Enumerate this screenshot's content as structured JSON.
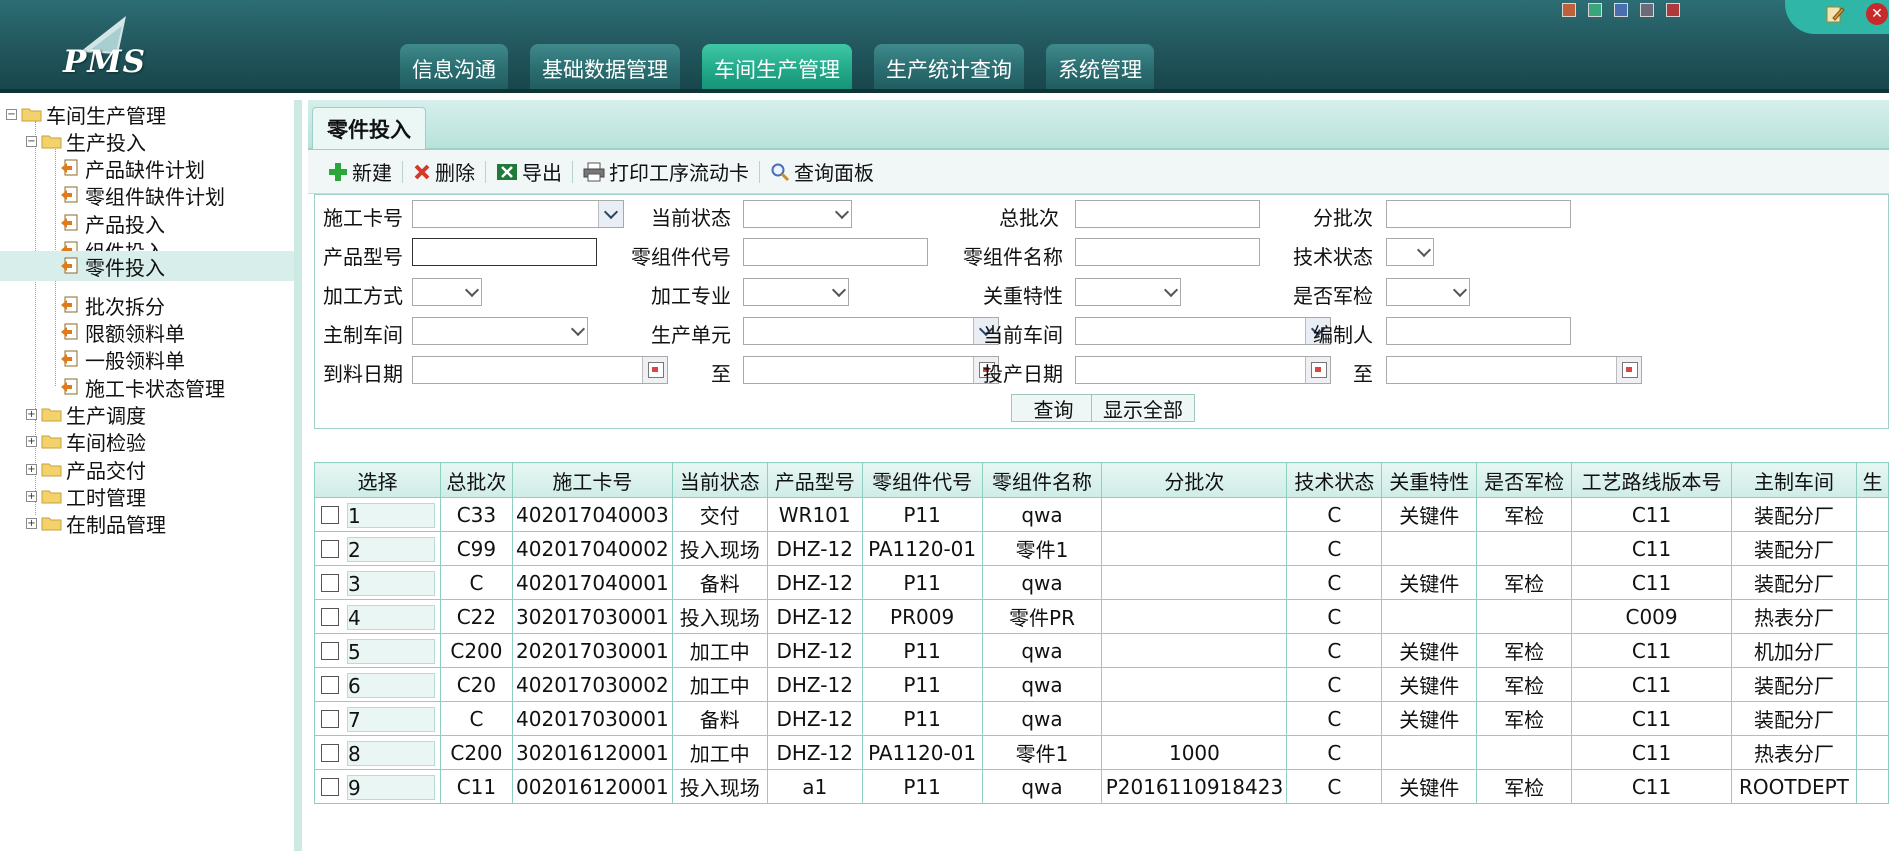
{
  "header": {
    "logo_text": "PMS",
    "nav": [
      {
        "label": "信息沟通",
        "active": false
      },
      {
        "label": "基础数据管理",
        "active": false
      },
      {
        "label": "车间生产管理",
        "active": true
      },
      {
        "label": "生产统计查询",
        "active": false
      },
      {
        "label": "系统管理",
        "active": false
      }
    ],
    "skin_colors": [
      "#c0603a",
      "#3aa57a",
      "#4a6fb0",
      "#6b6b7a",
      "#b03a3a"
    ]
  },
  "sidebar": {
    "root": "车间生产管理",
    "group1": "生产投入",
    "items": [
      "产品缺件计划",
      "零组件缺件计划",
      "产品投入",
      "组件投入",
      "零件投入",
      "批次拆分",
      "限额领料单",
      "一般领料单",
      "施工卡状态管理"
    ],
    "selected": "零件投入",
    "groups": [
      "生产调度",
      "车间检验",
      "产品交付",
      "工时管理",
      "在制品管理"
    ]
  },
  "tab": {
    "title": "零件投入"
  },
  "toolbar": {
    "new": "新建",
    "delete": "删除",
    "export": "导出",
    "print": "打印工序流动卡",
    "query_panel": "查询面板"
  },
  "form": {
    "labels": {
      "card_no": "施工卡号",
      "status": "当前状态",
      "total_batch": "总批次",
      "sub_batch": "分批次",
      "product_model": "产品型号",
      "part_code": "零组件代号",
      "part_name": "零组件名称",
      "tech_status": "技术状态",
      "process_method": "加工方式",
      "process_major": "加工专业",
      "key_feature": "关重特性",
      "military": "是否军检",
      "main_workshop": "主制车间",
      "prod_unit": "生产单元",
      "cur_workshop": "当前车间",
      "editor": "编制人",
      "arrive_date": "到料日期",
      "to1": "至",
      "start_date": "投产日期",
      "to2": "至"
    },
    "buttons": {
      "query": "查询",
      "show_all": "显示全部"
    }
  },
  "table": {
    "columns": [
      "选择",
      "总批次",
      "施工卡号",
      "当前状态",
      "产品型号",
      "零组件代号",
      "零组件名称",
      "分批次",
      "技术状态",
      "关重特性",
      "是否军检",
      "工艺路线版本号",
      "主制车间",
      "生"
    ],
    "rows": [
      {
        "no": "1",
        "total_batch": "C33",
        "card_no": "402017040003",
        "status": "交付",
        "model": "WR101",
        "code": "P11",
        "name": "qwa",
        "sub_batch": "",
        "tech": "C",
        "key": "关键件",
        "mil": "军检",
        "route": "C11",
        "workshop": "装配分厂"
      },
      {
        "no": "2",
        "total_batch": "C99",
        "card_no": "402017040002",
        "status": "投入现场",
        "model": "DHZ-12",
        "code": "PA1120-01",
        "name": "零件1",
        "sub_batch": "",
        "tech": "C",
        "key": "",
        "mil": "",
        "route": "C11",
        "workshop": "装配分厂"
      },
      {
        "no": "3",
        "total_batch": "C",
        "card_no": "402017040001",
        "status": "备料",
        "model": "DHZ-12",
        "code": "P11",
        "name": "qwa",
        "sub_batch": "",
        "tech": "C",
        "key": "关键件",
        "mil": "军检",
        "route": "C11",
        "workshop": "装配分厂"
      },
      {
        "no": "4",
        "total_batch": "C22",
        "card_no": "302017030001",
        "status": "投入现场",
        "model": "DHZ-12",
        "code": "PR009",
        "name": "零件PR",
        "sub_batch": "",
        "tech": "C",
        "key": "",
        "mil": "",
        "route": "C009",
        "workshop": "热表分厂"
      },
      {
        "no": "5",
        "total_batch": "C200",
        "card_no": "202017030001",
        "status": "加工中",
        "model": "DHZ-12",
        "code": "P11",
        "name": "qwa",
        "sub_batch": "",
        "tech": "C",
        "key": "关键件",
        "mil": "军检",
        "route": "C11",
        "workshop": "机加分厂"
      },
      {
        "no": "6",
        "total_batch": "C20",
        "card_no": "402017030002",
        "status": "加工中",
        "model": "DHZ-12",
        "code": "P11",
        "name": "qwa",
        "sub_batch": "",
        "tech": "C",
        "key": "关键件",
        "mil": "军检",
        "route": "C11",
        "workshop": "装配分厂"
      },
      {
        "no": "7",
        "total_batch": "C",
        "card_no": "402017030001",
        "status": "备料",
        "model": "DHZ-12",
        "code": "P11",
        "name": "qwa",
        "sub_batch": "",
        "tech": "C",
        "key": "关键件",
        "mil": "军检",
        "route": "C11",
        "workshop": "装配分厂"
      },
      {
        "no": "8",
        "total_batch": "C200",
        "card_no": "302016120001",
        "status": "加工中",
        "model": "DHZ-12",
        "code": "PA1120-01",
        "name": "零件1",
        "sub_batch": "1000",
        "tech": "C",
        "key": "",
        "mil": "",
        "route": "C11",
        "workshop": "热表分厂"
      },
      {
        "no": "9",
        "total_batch": "C11",
        "card_no": "002016120001",
        "status": "投入现场",
        "model": "a1",
        "code": "P11",
        "name": "qwa",
        "sub_batch": "P2016110918423",
        "tech": "C",
        "key": "关键件",
        "mil": "军检",
        "route": "C11",
        "workshop": "ROOTDEPT"
      }
    ]
  }
}
